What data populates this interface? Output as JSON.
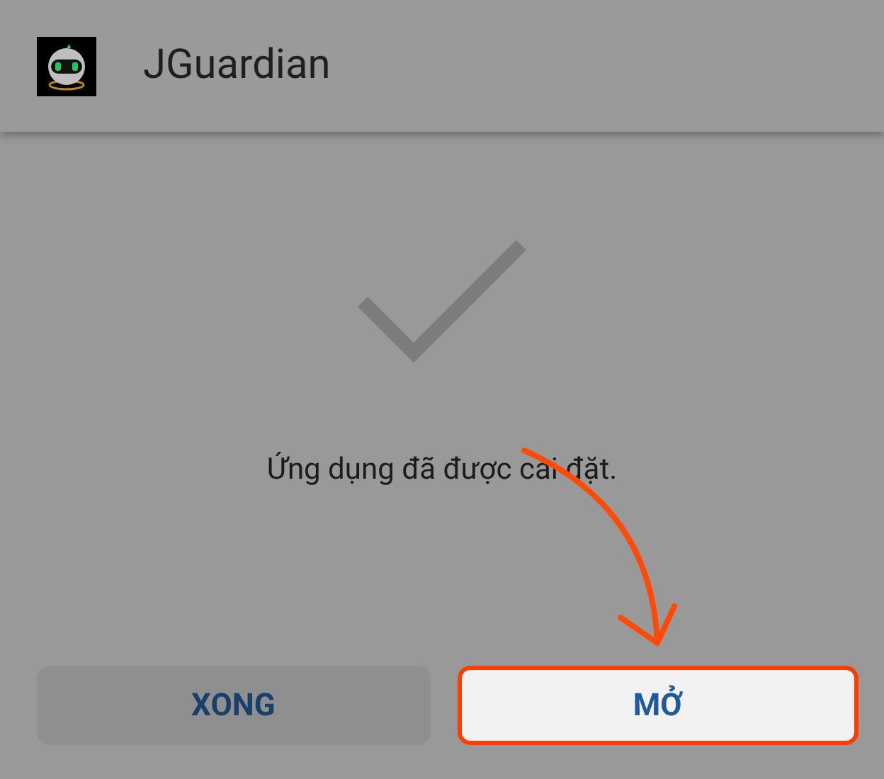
{
  "app_bar": {
    "title": "JGuardian"
  },
  "message": "Ứng dụng đã được cài đặt.",
  "buttons": [
    {
      "label": "XONG",
      "highlighted": false
    },
    {
      "label": "MỞ",
      "highlighted": true
    }
  ]
}
